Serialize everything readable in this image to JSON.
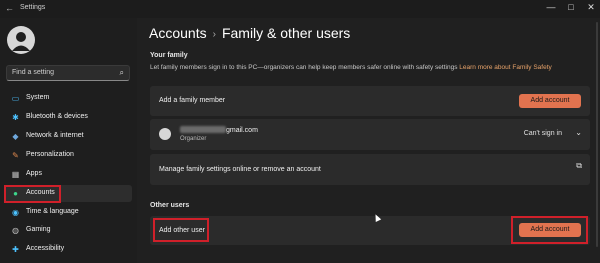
{
  "window": {
    "title": "Settings",
    "controls": [
      "—",
      "□",
      "✕"
    ]
  },
  "sidebar": {
    "search_placeholder": "Find a setting",
    "items": [
      {
        "label": "System",
        "icon": "display-icon",
        "color": "#4cc2ff",
        "glyph": "▭"
      },
      {
        "label": "Bluetooth & devices",
        "icon": "bluetooth-icon",
        "color": "#4cc2ff",
        "glyph": "✱"
      },
      {
        "label": "Network & internet",
        "icon": "wifi-icon",
        "color": "#6fa8dc",
        "glyph": "◆"
      },
      {
        "label": "Personalization",
        "icon": "brush-icon",
        "color": "#e08a4f",
        "glyph": "✎"
      },
      {
        "label": "Apps",
        "icon": "apps-icon",
        "color": "#bbbbbb",
        "glyph": "▦"
      },
      {
        "label": "Accounts",
        "icon": "person-icon",
        "color": "#3dd68c",
        "glyph": "●",
        "active": true
      },
      {
        "label": "Time & language",
        "icon": "globe-icon",
        "color": "#4cc2ff",
        "glyph": "◉"
      },
      {
        "label": "Gaming",
        "icon": "gamepad-icon",
        "color": "#bbbbbb",
        "glyph": "◍"
      },
      {
        "label": "Accessibility",
        "icon": "accessibility-icon",
        "color": "#4cc2ff",
        "glyph": "✚"
      }
    ]
  },
  "breadcrumb": {
    "parent": "Accounts",
    "separator": "›",
    "current": "Family & other users"
  },
  "your_family": {
    "title": "Your family",
    "description": "Let family members sign in to this PC—organizers can help keep members safer online with safety settings",
    "link": "Learn more about Family Safety",
    "add_member_label": "Add a family member",
    "add_account_button": "Add account",
    "member": {
      "email_suffix": "gmail.com",
      "role": "Organizer",
      "status": "Can't sign in"
    },
    "manage_label": "Manage family settings online or remove an account"
  },
  "other_users": {
    "title": "Other users",
    "add_other_label": "Add other user",
    "add_account_button": "Add account"
  },
  "colors": {
    "accent": "#e2734f",
    "highlight": "#d0202a"
  }
}
